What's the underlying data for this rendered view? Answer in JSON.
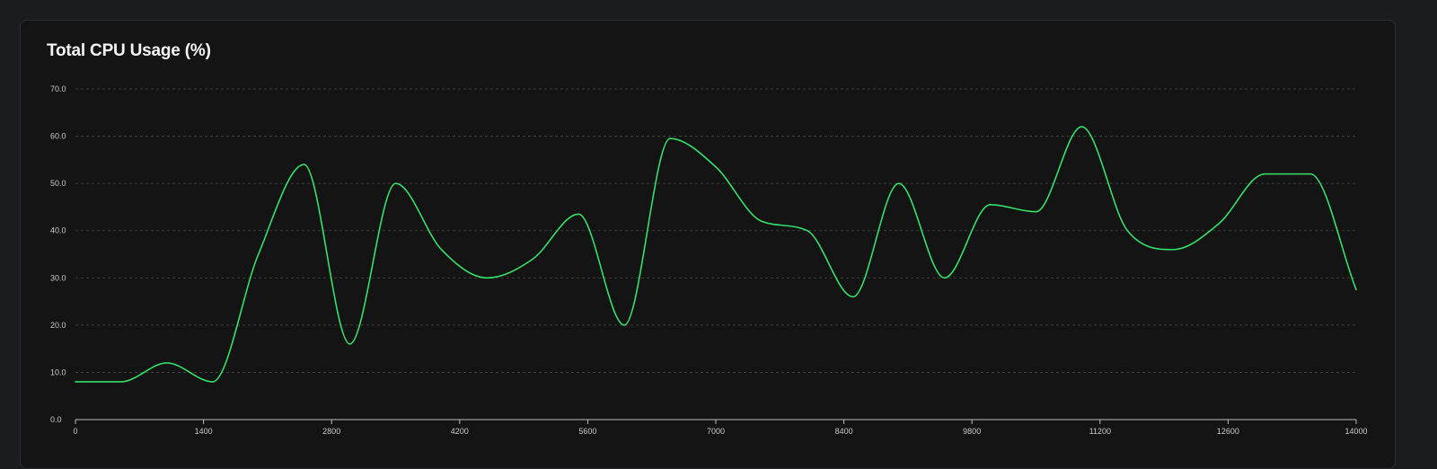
{
  "chart_data": {
    "type": "line",
    "title": "Total CPU Usage (%)",
    "xlabel": "",
    "ylabel": "",
    "xlim": [
      0,
      14000
    ],
    "ylim": [
      0,
      70
    ],
    "grid": true,
    "x_ticks": [
      "0",
      "1400",
      "2800",
      "4200",
      "5600",
      "7000",
      "8400",
      "9800",
      "11200",
      "12600",
      "14000"
    ],
    "y_ticks": [
      "0.0",
      "10.0",
      "20.0",
      "30.0",
      "40.0",
      "50.0",
      "60.0",
      "70.0"
    ],
    "colors": {
      "line": "#35e06a",
      "grid": "#4a4a4a",
      "axis": "#bdbdbd"
    },
    "series": [
      {
        "x": [
          0,
          500,
          1000,
          1500,
          2000,
          2500,
          3000,
          3500,
          4000,
          4500,
          5000,
          5500,
          6000,
          6500,
          7000,
          7500,
          8000,
          8500,
          9000,
          9500,
          10000,
          10500,
          11000,
          11500,
          12000,
          12500,
          13000,
          13500,
          14000
        ],
        "values": [
          8,
          8,
          12,
          8,
          35,
          54,
          16,
          50,
          36,
          30,
          34,
          43.5,
          20,
          59.5,
          53.5,
          42,
          40,
          26,
          50,
          30,
          45.5,
          44,
          62,
          40,
          36,
          41.5,
          52,
          52,
          27.5
        ]
      }
    ]
  }
}
